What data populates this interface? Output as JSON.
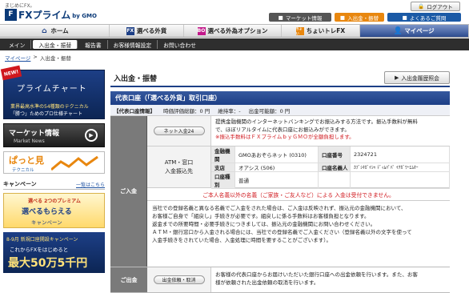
{
  "header": {
    "tagline": "まじめにFX。",
    "logo_mark": "F",
    "logo_text": "FXプライム",
    "logo_by": "by GMO",
    "login_label": "ログアウト",
    "market_label": "マーケット情報",
    "deposit_label": "入出金・振替",
    "faq_label": "よくあるご質問"
  },
  "gnav": {
    "items": [
      {
        "label": "ホーム",
        "icon": "home-icon"
      },
      {
        "label": "選べる外貨",
        "icon": "fx-icon",
        "mark": "FX"
      },
      {
        "label": "選べる外為オプション",
        "icon": "bo-icon",
        "mark": "BO"
      },
      {
        "label": "ちょいトレFX",
        "icon": "choi-icon",
        "mark": "ちょい"
      },
      {
        "label": "マイページ",
        "icon": "user-icon"
      }
    ]
  },
  "subnav": {
    "items": [
      "メイン",
      "入出金・振替",
      "報告書",
      "お客様情報設定",
      "お問い合わせ"
    ]
  },
  "breadcrumb": {
    "home": "マイページ",
    "sep": ">",
    "current": "入出金・振替"
  },
  "left": {
    "new_badge": "NEW!",
    "prime_title": "プライムチャート",
    "prime_sub1": "業界最高水準の54種類のテクニカル",
    "prime_sub2": "「勝つ」ためのプロ仕様チャート",
    "market_title": "マーケット情報",
    "market_sub": "Market News",
    "pasto_title": "ぱっと見",
    "pasto_sub": "テクニカル",
    "campaign_title": "キャンペーン",
    "campaign_more": "一覧はこちら",
    "camp1_a": "選べる 2つのプレミアム",
    "camp1_b": "選べるもらえる",
    "camp1_c": "キャンペーン",
    "camp2_a": "8-9月 新規口座開設キャンペーン",
    "camp2_b": "これからFXをはじめると",
    "camp2_c": "最大50万5千円"
  },
  "main": {
    "title": "入出金・振替",
    "history_btn": "入出金履歴照会",
    "section_title": "代表口座（「選べる外貨」取引口座）",
    "info": {
      "label": "【代表口座情報】",
      "eval": "時価評価総額：0 円",
      "margin": "維持率：-",
      "available": "出金可能額：0 円"
    },
    "deposit_label": "ご入金",
    "net_btn": "ネット入金24",
    "net_text1": "提携金融機関のインターネットバンキングでお振込みする方法です。振込手数料が無料",
    "net_text2": "で、ほぼリアルタイムに代表口座にお振込みができます。",
    "net_text3": "※振込手数料はＦＸプライムｂｙＧＭＯが全額負担します。",
    "atm_label1": "ATM・窓口",
    "atm_label2": "入金振込先",
    "bank": {
      "h_bank": "金融機関",
      "bank": "GMOあおぞらネット (0310)",
      "h_no": "口座番号",
      "no": "2324721",
      "h_branch": "支店",
      "branch": "オアシス (506)",
      "h_name": "口座名義人",
      "name": "ｶﾌﾞｼｷｶﾞｲｼｬ ﾃﾞｨﾑﾊﾟﾊﾟ ｲﾁｶﾞﾜｰｴﾑｵｰ",
      "h_type": "口座種別",
      "type": "普通"
    },
    "warn": "ご本人名義以外の名義（ご家族・ご友人など）による 入金は受付できません。",
    "notes": [
      "当社での登録名義と異なる名義でご入金をされた場合は、ご入金は反映されず、振込元の金融機関において、",
      "お客様ご自身で「組戻し」手続きが必要です。組戻しに係る手数料はお客様負担となります。",
      "返金までの所要時間・必要手続きにつきましては、振込元の金融機関にお問い合わせください。",
      "ＡＴＭ・銀行窓口から入金される場合には、当社での登録名義でご入金ください（登録名義以外の文字を使って",
      "入金手続きをされていた場合、入金処理に時間を要することがございます）。"
    ],
    "withdraw_label": "ご出金",
    "withdraw_btn": "出金依頼・取消",
    "withdraw_text1": "お客様の代表口座からお届けいただいた銀行口座への出金依頼を行います。また、お客",
    "withdraw_text2": "様が依頼された出金依頼の取消を行います。"
  }
}
